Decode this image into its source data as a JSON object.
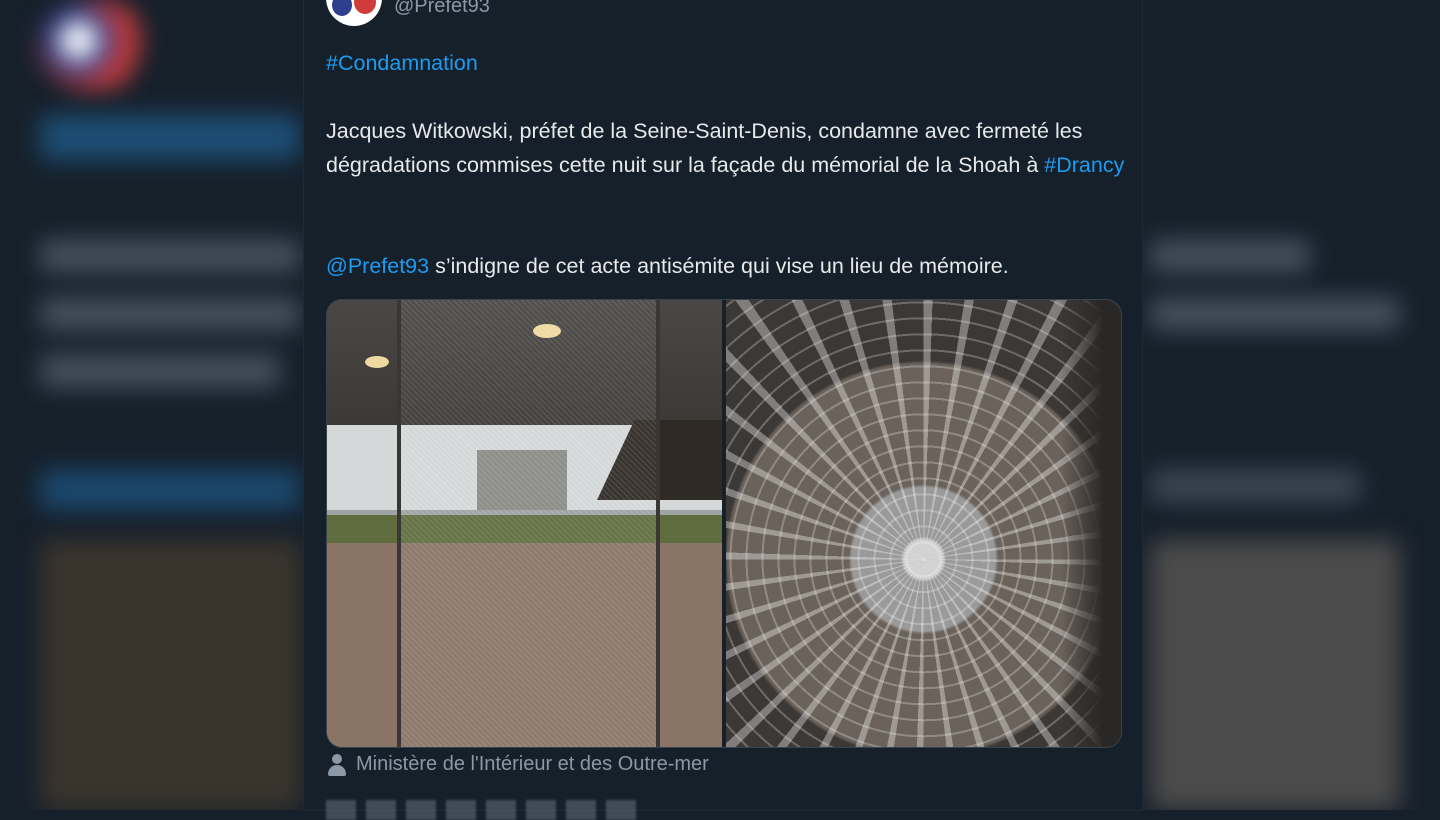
{
  "tweet": {
    "handle": "@Prefet93",
    "hashtag_line": "#Condamnation",
    "body_part1": "Jacques Witkowski, préfet de la Seine-Saint-Denis, condamne avec fermeté les dégradations commises cette nuit sur la façade du mémorial de la Shoah à ",
    "body_hashtag": "#Drancy",
    "mention": "@Prefet93",
    "body_part2": " s’indigne de cet acte antisémite qui vise un lieu de mémoire.",
    "media_credit": "Ministère de l'Intérieur et des Outre-mer"
  },
  "colors": {
    "background": "#15202b",
    "link": "#1d9bf0",
    "secondary_text": "#8b98a5",
    "primary_text": "#e7e9ea"
  },
  "icons": {
    "avatar": "french-flag-avatar",
    "credit": "person-icon"
  }
}
